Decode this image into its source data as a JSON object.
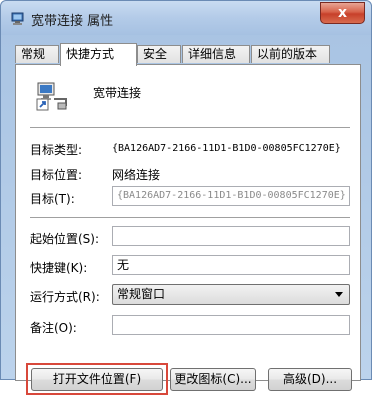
{
  "window": {
    "title": "宽带连接 属性",
    "close_glyph": "x"
  },
  "tabs": [
    {
      "label": "常规",
      "active": false
    },
    {
      "label": "快捷方式",
      "active": true
    },
    {
      "label": "安全",
      "active": false
    },
    {
      "label": "详细信息",
      "active": false
    },
    {
      "label": "以前的版本",
      "active": false
    }
  ],
  "shortcut": {
    "name": "宽带连接",
    "icon": "network-connection-shortcut-icon"
  },
  "properties": {
    "target_type_label": "目标类型:",
    "target_type_value": "{BA126AD7-2166-11D1-B1D0-00805FC1270E}",
    "target_location_label": "目标位置:",
    "target_location_value": "网络连接",
    "target_label": "目标(T):",
    "target_value": "{BA126AD7-2166-11D1-B1D0-00805FC1270E}",
    "start_in_label": "起始位置(S):",
    "start_in_value": "",
    "shortcut_key_label": "快捷键(K):",
    "shortcut_key_value": "无",
    "run_label": "运行方式(R):",
    "run_value": "常规窗口",
    "comment_label": "备注(O):",
    "comment_value": ""
  },
  "buttons": {
    "open_file_location": "打开文件位置(F)",
    "change_icon": "更改图标(C)...",
    "advanced": "高级(D)..."
  },
  "colors": {
    "highlight_box": "#d8483b",
    "close_button": "#c7402a"
  }
}
